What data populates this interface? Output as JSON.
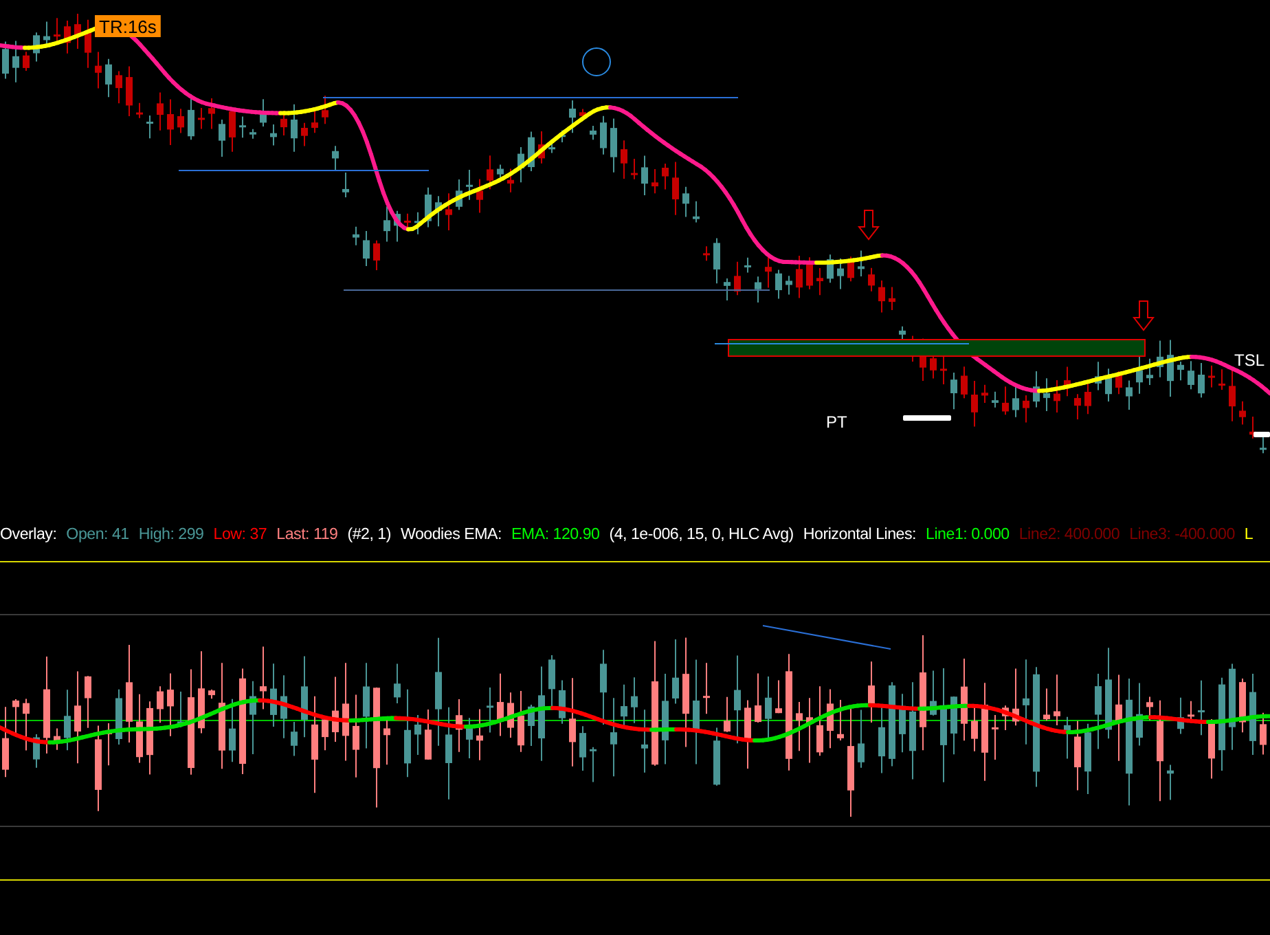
{
  "price_chart": {
    "annotations": [
      {
        "kind": "badge",
        "text": "TR:16s"
      },
      {
        "kind": "label",
        "text": "PT"
      },
      {
        "kind": "label",
        "text": "TSL"
      }
    ]
  },
  "legend": [
    {
      "text": "Overlay:",
      "color": "#ffffff"
    },
    {
      "text": "Open: 41",
      "color": "#4a9696"
    },
    {
      "text": "High: 299",
      "color": "#4a9696"
    },
    {
      "text": "Low: 37",
      "color": "#ff0000"
    },
    {
      "text": "Last: 119",
      "color": "#ff8080"
    },
    {
      "text": "(#2, 1)",
      "color": "#ffffff"
    },
    {
      "text": "Woodies EMA:",
      "color": "#ffffff"
    },
    {
      "text": "EMA: 120.90",
      "color": "#00ff00"
    },
    {
      "text": "(4, 1e-006, 15, 0, HLC Avg)",
      "color": "#ffffff"
    },
    {
      "text": "Horizontal Lines:",
      "color": "#ffffff"
    },
    {
      "text": "Line1: 0.000",
      "color": "#00ff00"
    },
    {
      "text": "Line2: 400.000",
      "color": "#800000"
    },
    {
      "text": "Line3: -400.000",
      "color": "#800000"
    },
    {
      "text": "L",
      "color": "#ffff00"
    }
  ]
}
